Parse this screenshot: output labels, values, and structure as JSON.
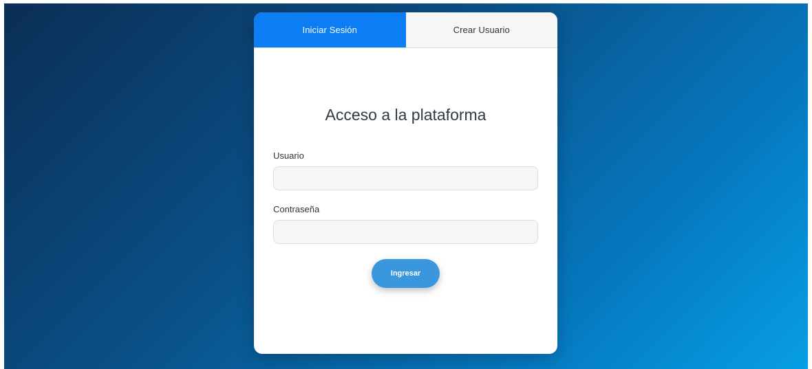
{
  "tabs": {
    "login_label": "Iniciar Sesión",
    "register_label": "Crear Usuario"
  },
  "form": {
    "title": "Acceso a la plataforma",
    "username_label": "Usuario",
    "username_value": "",
    "password_label": "Contraseña",
    "password_value": "",
    "submit_label": "Ingresar"
  },
  "colors": {
    "active_tab": "#0b7ef4",
    "submit_button": "#3b97dd",
    "background_gradient_start": "#0b2e55",
    "background_gradient_end": "#079ee5"
  }
}
